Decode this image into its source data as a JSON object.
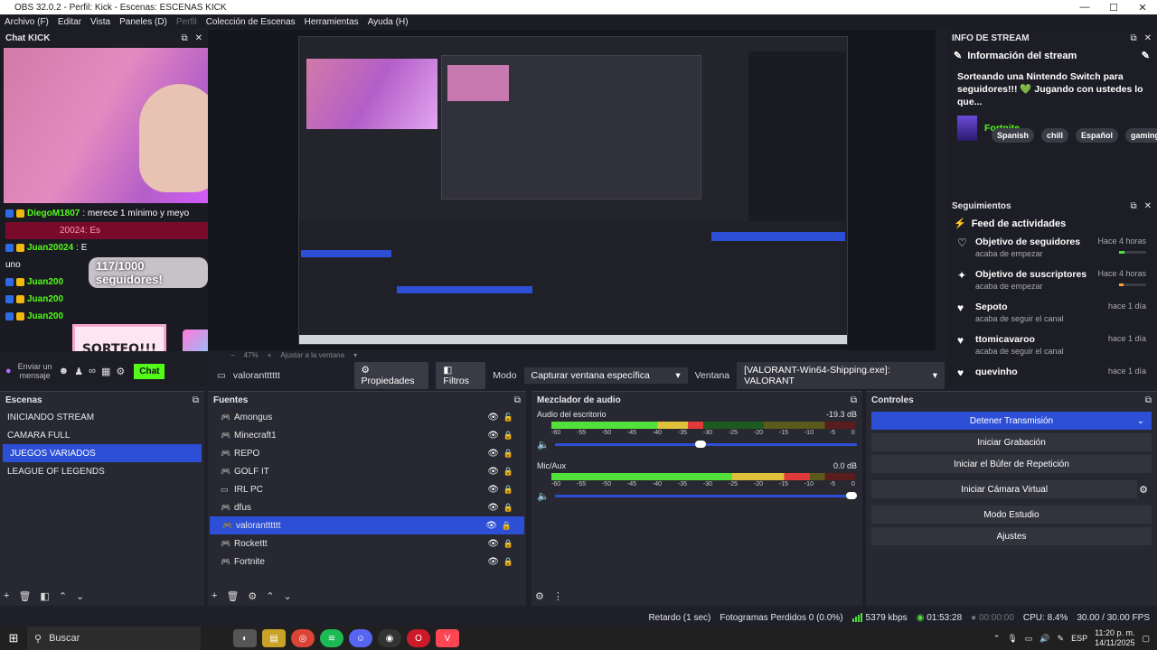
{
  "window": {
    "title": "OBS 32.0.2 - Perfil: Kick - Escenas: ESCENAS KICK"
  },
  "menu": [
    "Archivo (F)",
    "Editar",
    "Vista",
    "Paneles (D)",
    "Perfil",
    "Colección de Escenas",
    "Herramientas",
    "Ayuda (H)"
  ],
  "chat": {
    "title": "Chat KICK",
    "lines": [
      {
        "user": "DiegoM1807",
        "msg": ": merece 1 mínimo y meyo"
      },
      {
        "user": "",
        "msg": "20024: Es"
      },
      {
        "user": "Juan20024",
        "msg": ": E"
      },
      {
        "user": "",
        "msg": "uno"
      },
      {
        "user": "Juan200",
        "msg": ""
      },
      {
        "user": "Juan200",
        "msg": ""
      },
      {
        "user": "Juan200",
        "msg": ""
      }
    ],
    "follow_goal": "117/1000 seguidores!",
    "sorteo": "SORTEO!!!",
    "send_placeholder": "Enviar un mensaje",
    "chat_button": "Chat"
  },
  "preview": {
    "zoom": "47%",
    "fit": "Ajustar a la ventana"
  },
  "toolbar": {
    "source": "valorantttttt",
    "props": "Propiedades",
    "filters": "Filtros",
    "mode_label": "Modo",
    "mode_value": "Capturar ventana específica",
    "window_label": "Ventana",
    "window_value": "[VALORANT-Win64-Shipping.exe]: VALORANT"
  },
  "info": {
    "title": "INFO DE STREAM",
    "heading": "Información del stream",
    "description": "Sorteando una Nintendo Switch para seguidores!!! 💚 Jugando con ustedes lo que...",
    "game": "Fortnite",
    "tags": [
      "Spanish",
      "chill",
      "Español",
      "gaming"
    ]
  },
  "seguimientos": {
    "title": "Seguimientos",
    "heading": "Feed de actividades",
    "items": [
      {
        "icon": "heart",
        "name": "Objetivo de seguidores",
        "sub": "acaba de empezar",
        "time": "Hace 4 horas",
        "bar": 0.2,
        "bar_color": "#53e03a"
      },
      {
        "icon": "star",
        "name": "Objetivo de suscriptores",
        "sub": "acaba de empezar",
        "time": "Hace 4 horas",
        "bar": 0.15,
        "bar_color": "#f2a33a"
      },
      {
        "icon": "heart",
        "name": "Sepoto",
        "sub": "acaba de seguir el canal",
        "time": "hace 1 día"
      },
      {
        "icon": "heart",
        "name": "ttomicavaroo",
        "sub": "acaba de seguir el canal",
        "time": "hace 1 día"
      },
      {
        "icon": "heart",
        "name": "quevinho",
        "sub": "",
        "time": "hace 1 día"
      }
    ]
  },
  "escenas": {
    "title": "Escenas",
    "items": [
      "INICIANDO STREAM",
      "CAMARA FULL",
      "JUEGOS VARIADOS",
      "LEAGUE OF LEGENDS"
    ],
    "selected": 2
  },
  "fuentes": {
    "title": "Fuentes",
    "items": [
      {
        "name": "Amongus",
        "locked": false
      },
      {
        "name": "Minecraft1",
        "locked": true
      },
      {
        "name": "REPO",
        "locked": true
      },
      {
        "name": "GOLF IT",
        "locked": true
      },
      {
        "name": "IRL PC",
        "locked": true,
        "monitor": true
      },
      {
        "name": "dfus",
        "locked": true
      },
      {
        "name": "valorantttttt",
        "locked": true
      },
      {
        "name": "Rockettt",
        "locked": true
      },
      {
        "name": "Fortnite",
        "locked": true
      }
    ],
    "selected": 6
  },
  "mezclador": {
    "title": "Mezclador de audio",
    "channels": [
      {
        "name": "Audio del escritorio",
        "db": "-19.3 dB",
        "level": 0.5,
        "volume": 0.5
      },
      {
        "name": "Mic/Aux",
        "db": "0.0 dB",
        "level": 0.85,
        "volume": 1.0
      }
    ],
    "ticks": [
      "-60",
      "-55",
      "-50",
      "-45",
      "-40",
      "-35",
      "-30",
      "-25",
      "-20",
      "-15",
      "-10",
      "-5",
      "0"
    ]
  },
  "controles": {
    "title": "Controles",
    "buttons": [
      "Detener Transmisión",
      "Iniciar Grabación",
      "Iniciar el Búfer de Repetición",
      "Iniciar Cámara Virtual",
      "Modo Estudio",
      "Ajustes"
    ]
  },
  "status": {
    "delay": "Retardo (1 sec)",
    "dropped": "Fotogramas Perdidos 0 (0.0%)",
    "kbps": "5379 kbps",
    "stream_time": "01:53:28",
    "rec_time": "00:00:00",
    "cpu": "CPU: 8.4%",
    "fps": "30.00 / 30.00 FPS"
  },
  "taskbar": {
    "search": "Buscar",
    "lang": "ESP",
    "time": "11:20 p. m.",
    "date": "14/11/2025"
  }
}
